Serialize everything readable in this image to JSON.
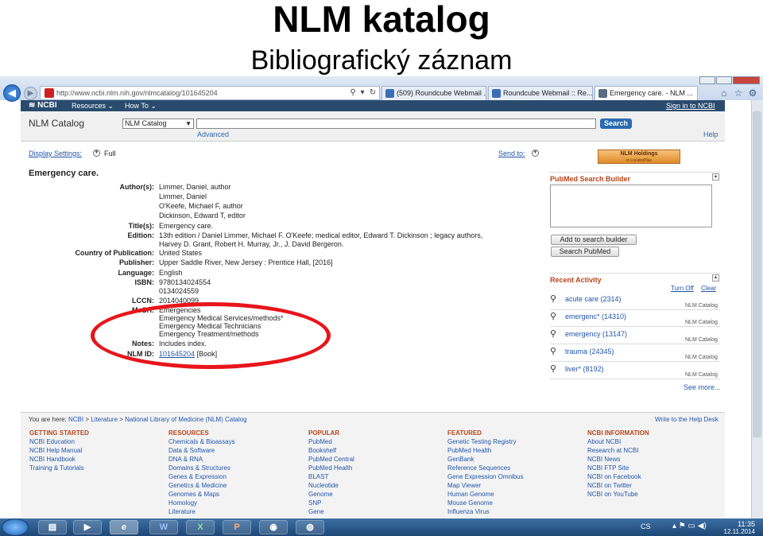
{
  "slide": {
    "title": "NLM katalog",
    "subtitle": "Bibliografický záznam"
  },
  "browser": {
    "address": "http://www.ncbi.nlm.nih.gov/nlmcatalog/101645204",
    "tabs": [
      {
        "label": "(509) Roundcube Webmail ...",
        "color": "#3a6fb6"
      },
      {
        "label": "Roundcube Webmail :: Re...",
        "color": "#3a6fb6"
      },
      {
        "label": "Emergency care. - NLM ...",
        "color": "#5a6c80"
      }
    ]
  },
  "ncbi": {
    "logo": "NCBI",
    "resources": "Resources",
    "howto": "How To",
    "signin": "Sign in to NCBI"
  },
  "search": {
    "db_title": "NLM Catalog",
    "db_select": "NLM Catalog",
    "button": "Search",
    "advanced": "Advanced",
    "help": "Help"
  },
  "display": {
    "settings_label": "Display Settings:",
    "settings_value": "Full",
    "sendto_label": "Send to:"
  },
  "record": {
    "title": "Emergency care.",
    "fields": [
      {
        "label": "Author(s):",
        "lines": [
          "Limmer, Daniel, author",
          "Limmer, Daniel",
          "O'Keefe, Michael F, author",
          "Dickinson, Edward T, editor"
        ]
      },
      {
        "label": "Title(s):",
        "lines": [
          "Emergency care."
        ]
      },
      {
        "label": "Edition:",
        "lines": [
          "13th edition / Daniel Limmer, Michael F. O'Keefe; medical editor, Edward T. Dickinson ; legacy authors,",
          "Harvey D. Grant, Robert H. Murray, Jr., J. David Bergeron."
        ]
      },
      {
        "label": "Country of Publication:",
        "lines": [
          "United States"
        ]
      },
      {
        "label": "Publisher:",
        "lines": [
          "Upper Saddle River, New Jersey : Prentice Hall, [2016]"
        ]
      },
      {
        "label": "Language:",
        "lines": [
          "English"
        ]
      },
      {
        "label": "ISBN:",
        "lines": [
          "9780134024554",
          "0134024559"
        ]
      },
      {
        "label": "LCCN:",
        "lines": [
          "2014040099"
        ]
      },
      {
        "label": "MeSH:",
        "lines": [
          "Emergencies",
          "Emergency Medical Services/methods*",
          "Emergency Medical Technicians",
          "Emergency Treatment/methods"
        ]
      },
      {
        "label": "Notes:",
        "lines": [
          "Includes index."
        ]
      }
    ],
    "nlm_id_label": "NLM ID:",
    "nlm_id": "101645204",
    "nlm_id_suffix": "[Book]"
  },
  "sidebar": {
    "holdings_line1": "NLM Holdings",
    "holdings_line2": "in LocatorPlus",
    "builder_title": "PubMed Search Builder",
    "add_button": "Add to search builder",
    "search_pubmed": "Search PubMed",
    "recent_title": "Recent Activity",
    "turn_off": "Turn Off",
    "clear": "Clear",
    "recent": [
      {
        "query": "acute care (2314)",
        "source": "NLM Catalog"
      },
      {
        "query": "emergenc* (14310)",
        "source": "NLM Catalog"
      },
      {
        "query": "emergency (13147)",
        "source": "NLM Catalog"
      },
      {
        "query": "trauma (24345)",
        "source": "NLM Catalog"
      },
      {
        "query": "liver* (8192)",
        "source": "NLM Catalog"
      }
    ],
    "see_more": "See more..."
  },
  "footer": {
    "you_are_here": "You are here:",
    "crumbs": [
      "NCBI",
      "Literature",
      "National Library of Medicine (NLM) Catalog"
    ],
    "help_desk": "Write to the Help Desk",
    "columns": [
      {
        "heading": "GETTING STARTED",
        "links": [
          "NCBI Education",
          "NCBI Help Manual",
          "NCBI Handbook",
          "Training & Tutorials"
        ]
      },
      {
        "heading": "RESOURCES",
        "links": [
          "Chemicals & Bioassays",
          "Data & Software",
          "DNA & RNA",
          "Domains & Structures",
          "Genes & Expression",
          "Genetics & Medicine",
          "Genomes & Maps",
          "Homology",
          "Literature"
        ]
      },
      {
        "heading": "POPULAR",
        "links": [
          "PubMed",
          "Bookshelf",
          "PubMed Central",
          "PubMed Health",
          "BLAST",
          "Nucleotide",
          "Genome",
          "SNP",
          "Gene"
        ]
      },
      {
        "heading": "FEATURED",
        "links": [
          "Genetic Testing Registry",
          "PubMed Health",
          "GenBank",
          "Reference Sequences",
          "Gene Expression Omnibus",
          "Map Viewer",
          "Human Genome",
          "Mouse Genome",
          "Influenza Virus"
        ]
      },
      {
        "heading": "NCBI INFORMATION",
        "links": [
          "About NCBI",
          "Research at NCBI",
          "NCBI News",
          "NCBI FTP Site",
          "NCBI on Facebook",
          "NCBI on Twitter",
          "NCBI on YouTube"
        ]
      }
    ]
  },
  "taskbar": {
    "apps": [
      "W",
      "X",
      "P"
    ],
    "lang": "CS",
    "time": "11:35",
    "date": "12.11.2014"
  },
  "colors": {
    "ncbi_bar": "#2a4b6e",
    "accent_heading": "#b5451b",
    "link": "#2255aa",
    "annotation": "#e8151b"
  }
}
